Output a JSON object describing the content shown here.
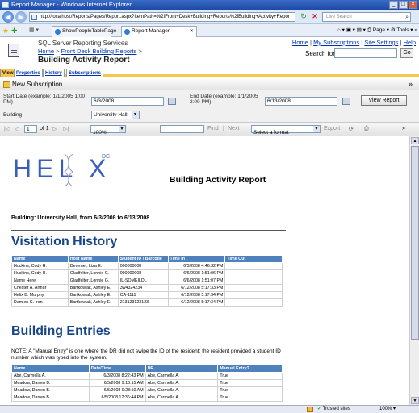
{
  "window": {
    "title": "Report Manager - Windows Internet Explorer"
  },
  "browser": {
    "url": "http://localhost/Reports/Pages/Report.aspx?ItemPath=%2fFront+Desk+Building+Reports%2fBuilding+Activity+Repor",
    "search_placeholder": "Live Search",
    "tabs": [
      {
        "label": "ShowPeopleTablePage"
      },
      {
        "label": "Report Manager"
      }
    ],
    "tools": "⌂ ▾ ▣ ▾ ▤ ▾ ⎙ Page ▾ ⚙ Tools ▾ »"
  },
  "rs": {
    "title": "SQL Server Reporting Services",
    "breadcrumb_home": "Home",
    "breadcrumb_sep": ">",
    "breadcrumb_folder": "Front Desk Building Reports",
    "breadcrumb_end": ">",
    "report_name": "Building Activity Report",
    "link_home": "Home",
    "link_subs": "My Subscriptions",
    "link_settings": "Site Settings",
    "link_help": "Help",
    "sep": "|",
    "search_label": "Search for:",
    "go": "Go"
  },
  "view_tabs": [
    {
      "label": "View"
    },
    {
      "label": "Properties"
    },
    {
      "label": "History"
    },
    {
      "label": "Subscriptions"
    }
  ],
  "subscription": {
    "label": "New Subscription"
  },
  "params": {
    "start_label": "Start Date (example: 1/1/2005 1:00 PM)",
    "start_value": "6/3/2008",
    "end_label": "End Date (example: 1/1/2005 2:00 PM)",
    "end_value": "6/13/2008",
    "building_label": "Building",
    "building_value": "University Hall",
    "view_report": "View Report"
  },
  "pager": {
    "first": "|◁",
    "prev": "◁",
    "page": "1",
    "of": "of 1",
    "next": "▷",
    "last": "▷|",
    "zoom": "100%",
    "find": "Find",
    "sep": "|",
    "findnext": "Next",
    "format": "Select a format",
    "export": "Export"
  },
  "report": {
    "logo_text": "HEL X",
    "logo_dc": "DC",
    "title": "Building Activity Report",
    "building_line": "Building: University Hall, from 6/3/2008 to 6/13/2008",
    "visitation_heading": "Visitation History",
    "visitation_columns": [
      "Name",
      "Host Name",
      "Student ID / Barcode",
      "Time In",
      "Time Out"
    ],
    "visitation_rows": [
      [
        "Huckins, Cody H.",
        "Deremer, Liza E.",
        "000000008",
        "6/3/2008 4:46:32 PM",
        ""
      ],
      [
        "Huckins, Cody H.",
        "Gladfelter, Lonnie G.",
        "000000008",
        "6/6/2008 1:51:06 PM",
        ""
      ],
      [
        "Name Here",
        "Gladfelter, Lonnie G.",
        "IL-SOMEILDL",
        "6/6/2008 1:51:07 PM",
        ""
      ],
      [
        "Chester A. Arthur",
        "Bartkowiak, Ashley E.",
        "3w4324234",
        "6/12/2008 5:17:33 PM",
        ""
      ],
      [
        "Helix B. Murphy",
        "Bartkowiak, Ashley E.",
        "CA-1111",
        "6/12/2008 5:17:34 PM",
        ""
      ],
      [
        "Damien C. Iron",
        "Bartkowiak, Ashley E.",
        "213123123123",
        "6/12/2008 5:17:34 PM",
        ""
      ]
    ],
    "entries_heading": "Building Entries",
    "note": "NOTE: A \"Manual Entry\" is one where the DR did not swipe the ID of the resident; the resident provided a student ID number which was typed into the system.",
    "entries_columns": [
      "Name",
      "Date/Time",
      "DR",
      "Manual Entry?"
    ],
    "entries_rows": [
      [
        "Abe, Carmella A.",
        "6/3/2008 8:22:43 PM",
        "Abe, Carmella A.",
        "True"
      ],
      [
        "Meadow, Darren B.",
        "6/5/2008 9:16:15 AM",
        "Abe, Carmella A.",
        "True"
      ],
      [
        "Meadow, Darren B.",
        "6/5/2008 9:28:50 AM",
        "Abe, Carmella A.",
        "True"
      ],
      [
        "Meadow, Darren B.",
        "6/5/2008 12:36:44 PM",
        "Abe, Carmella A.",
        "True"
      ]
    ]
  },
  "status": {
    "trusted": "Trusted sites",
    "zoom": "100% ▾"
  }
}
